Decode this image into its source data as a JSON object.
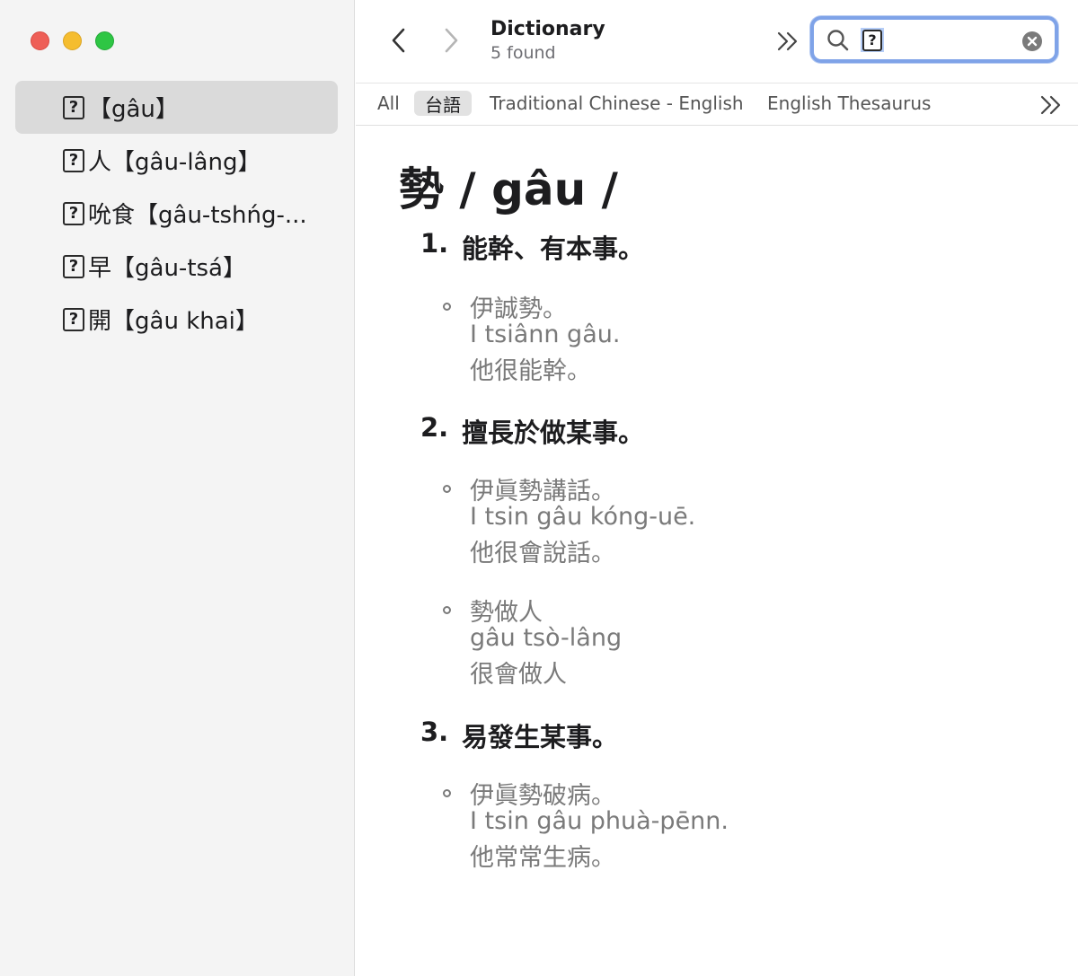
{
  "window": {
    "controls": [
      "close",
      "minimize",
      "zoom"
    ]
  },
  "sidebar": {
    "items": [
      {
        "prefix": "",
        "label": "【gâu】",
        "selected": true
      },
      {
        "prefix": "人",
        "label": "【gâu-lâng】",
        "selected": false
      },
      {
        "prefix": "吮食",
        "label": "【gâu-tshńg-...",
        "selected": false
      },
      {
        "prefix": "早",
        "label": "【gâu-tsá】",
        "selected": false
      },
      {
        "prefix": "開",
        "label": "【gâu khai】",
        "selected": false
      }
    ],
    "missing_glyph": "?"
  },
  "toolbar": {
    "title": "Dictionary",
    "subtitle": "5 found",
    "search_value": "?"
  },
  "tabs": [
    {
      "label": "All",
      "active": false
    },
    {
      "label": "台語",
      "active": true
    },
    {
      "label": "Traditional Chinese - English",
      "active": false
    },
    {
      "label": "English Thesaurus",
      "active": false
    }
  ],
  "entry": {
    "headword": "勢 / gâu /",
    "senses": [
      {
        "num": "1.",
        "definition": "能幹、有本事。",
        "examples": [
          {
            "hanji": "伊誠勢。",
            "romanization": "I tsiânn gâu.",
            "mandarin": "他很能幹。"
          }
        ]
      },
      {
        "num": "2.",
        "definition": "擅長於做某事。",
        "examples": [
          {
            "hanji": "伊眞勢講話。",
            "romanization": "I tsin gâu kóng-uē.",
            "mandarin": "他很會說話。"
          },
          {
            "hanji": "勢做人",
            "romanization": "gâu tsò-lâng",
            "mandarin": "很會做人"
          }
        ]
      },
      {
        "num": "3.",
        "definition": "易發生某事。",
        "examples": [
          {
            "hanji": "伊眞勢破病。",
            "romanization": "I tsin gâu phuà-pēnn.",
            "mandarin": "他常常生病。"
          }
        ]
      }
    ]
  },
  "colors": {
    "sidebar_bg": "#f4f4f4",
    "selected_row": "#dadada",
    "search_focus_ring": "#7fa3e8",
    "example_text": "#7a7a7a"
  }
}
